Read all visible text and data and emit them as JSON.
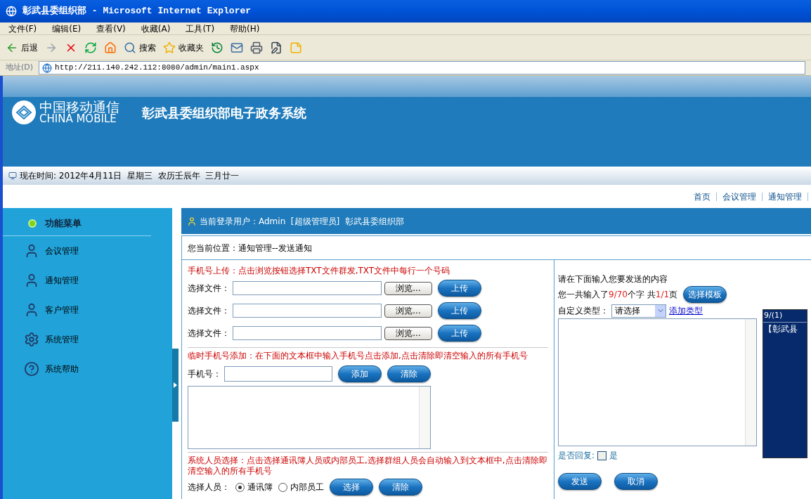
{
  "window": {
    "title": "彰武县委组织部 - Microsoft Internet Explorer"
  },
  "menu": [
    "文件(F)",
    "编辑(E)",
    "查看(V)",
    "收藏(A)",
    "工具(T)",
    "帮助(H)"
  ],
  "toolbar": [
    {
      "kind": "back",
      "label": "后退"
    },
    {
      "kind": "forward"
    },
    {
      "kind": "stop"
    },
    {
      "kind": "refresh"
    },
    {
      "kind": "home"
    },
    {
      "kind": "search",
      "label": "搜索"
    },
    {
      "kind": "favorites",
      "label": "收藏夹"
    },
    {
      "kind": "history"
    },
    {
      "kind": "mail"
    },
    {
      "kind": "print"
    },
    {
      "kind": "edit"
    },
    {
      "kind": "note"
    }
  ],
  "address": {
    "label": "地址(D)",
    "url": "http://211.140.242.112:8080/admin/main1.aspx"
  },
  "banner": {
    "logo_cn": "中国移动通信",
    "logo_en": "CHINA MOBILE",
    "title": "彰武县委组织部电子政务系统"
  },
  "date_bar": "现在时间: 2012年4月11日  星期三  农历壬辰年  三月廿一",
  "top_nav": [
    "首页",
    "会议管理",
    "通知管理"
  ],
  "sidebar": {
    "title": "功能菜单",
    "items": [
      "会议管理",
      "通知管理",
      "客户管理",
      "系统管理",
      "系统帮助"
    ]
  },
  "user_bar": "当前登录用户：Admin  [超级管理员]  彰武县委组织部",
  "breadcrumb": "您当前位置：通知管理--发送通知",
  "upload": {
    "hint": "手机号上传：点击浏览按钮选择TXT文件群发,TXT文件中每行一个号码",
    "rows": [
      {
        "label": "选择文件：",
        "browse": "浏览...",
        "upload": "上传"
      },
      {
        "label": "选择文件：",
        "browse": "浏览...",
        "upload": "上传"
      },
      {
        "label": "选择文件：",
        "browse": "浏览...",
        "upload": "上传"
      }
    ]
  },
  "temp": {
    "hint": "临时手机号添加：在下面的文本框中输入手机号点击添加,点击清除即清空输入的所有手机号",
    "label": "手机号：",
    "add": "添加",
    "clear": "清除"
  },
  "people": {
    "hint": "系统人员选择：点击选择通讯簿人员或内部员工,选择群组人员会自动输入到文本框中,点击清除即清空输入的所有手机号",
    "label": "选择人员：",
    "options": [
      {
        "label": "通讯簿",
        "selected": true
      },
      {
        "label": "内部员工",
        "selected": false
      }
    ],
    "select": "选择",
    "clear": "清除"
  },
  "message": {
    "prompt": "请在下面输入您要发送的内容",
    "counter": [
      {
        "text": "您一共输入了",
        "highlight": false
      },
      {
        "text": "9/70",
        "highlight": true
      },
      {
        "text": "个字 共",
        "highlight": false
      },
      {
        "text": "1/1",
        "highlight": true
      },
      {
        "text": "页",
        "highlight": false
      }
    ],
    "template_button": "选择模板",
    "type_label": "自定义类型：",
    "type_value": "请选择",
    "add_type": "添加类型",
    "reply_label": "是否回复:",
    "reply_option": {
      "label": "是",
      "checked": false
    },
    "send": "发送",
    "cancel": "取消"
  },
  "preview": {
    "count": "9/(1)",
    "text": "【彰武县"
  }
}
